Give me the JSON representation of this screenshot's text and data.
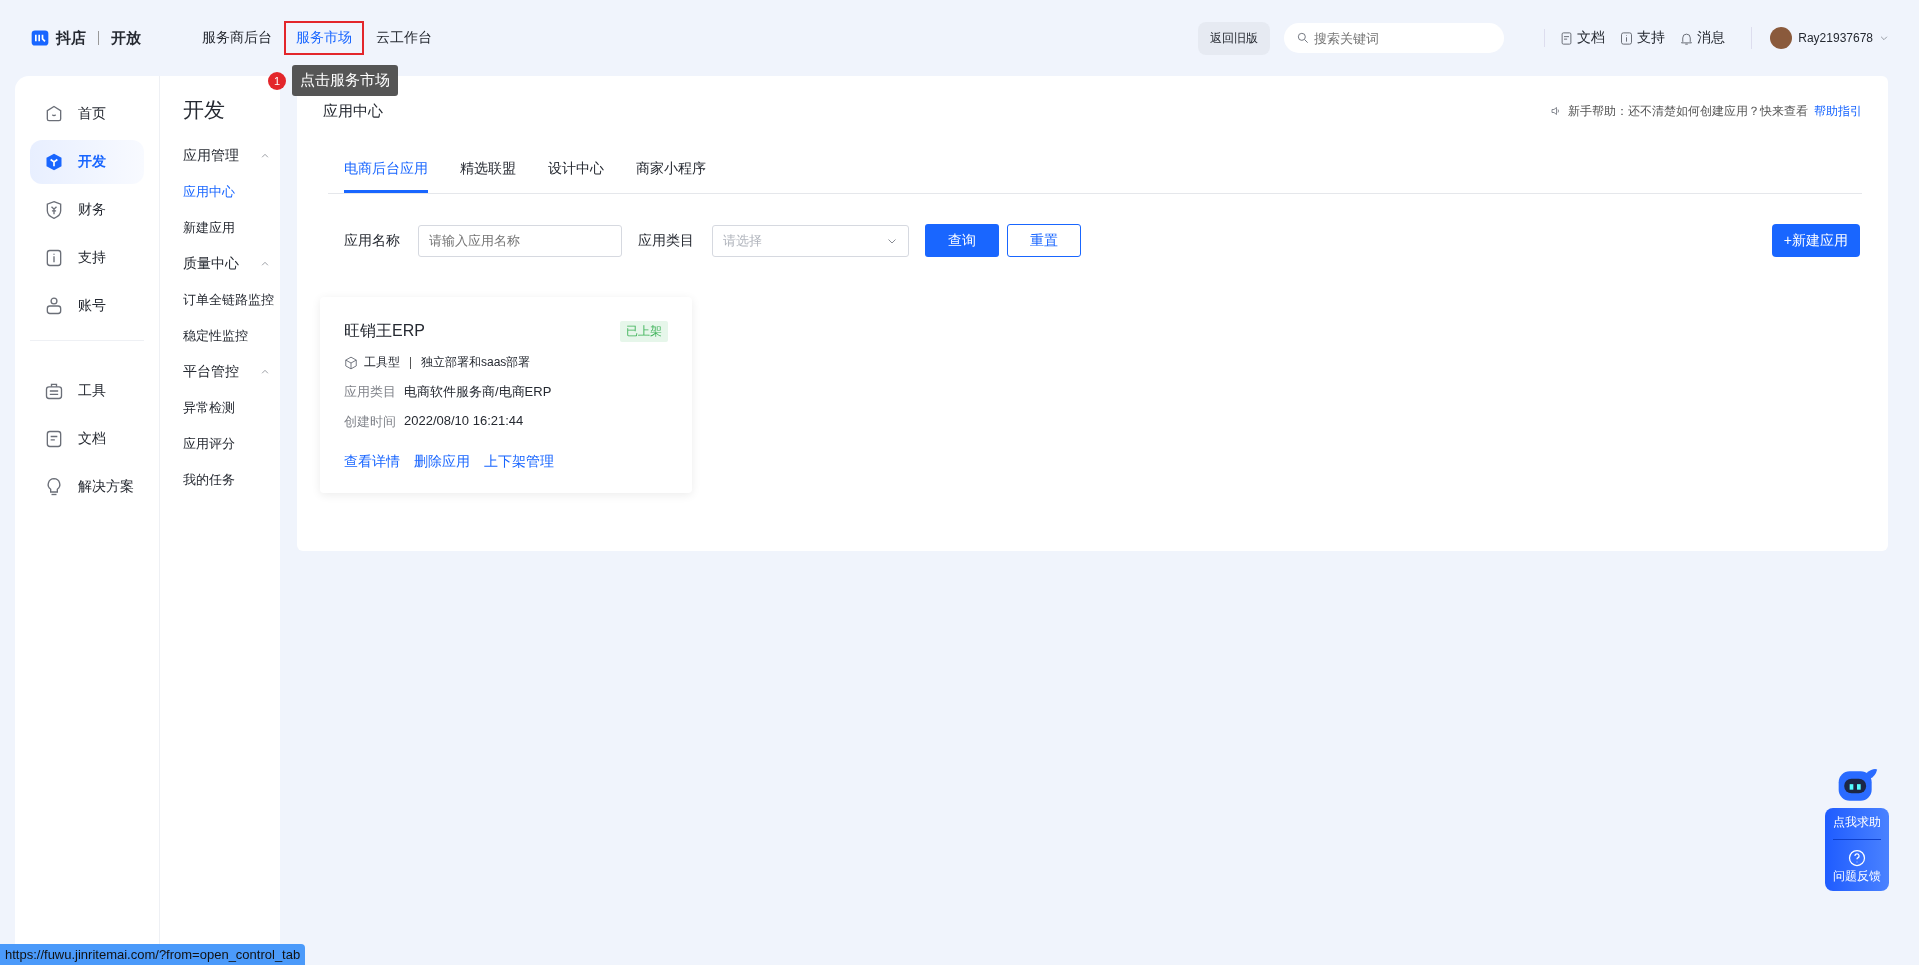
{
  "header": {
    "logo": {
      "brand": "抖店",
      "sub": "开放"
    },
    "nav": [
      {
        "label": "服务商后台",
        "selected": false,
        "outlined": false
      },
      {
        "label": "服务市场",
        "selected": true,
        "outlined": true
      },
      {
        "label": "云工作台",
        "selected": false,
        "outlined": false
      }
    ],
    "guide": {
      "step": "1",
      "text": "点击服务市场"
    },
    "old_version_button": "返回旧版",
    "search": {
      "placeholder": "搜索关键词"
    },
    "links": [
      {
        "label": "文档",
        "kind": "doc"
      },
      {
        "label": "支持",
        "kind": "support"
      },
      {
        "label": "消息",
        "kind": "bell"
      }
    ],
    "user": {
      "name": "Ray21937678"
    }
  },
  "sidebar": {
    "items": [
      {
        "label": "首页",
        "kind": "home",
        "selected": false
      },
      {
        "label": "开发",
        "kind": "dev",
        "selected": true
      },
      {
        "label": "财务",
        "kind": "finance",
        "selected": false
      },
      {
        "label": "支持",
        "kind": "support",
        "selected": false
      },
      {
        "label": "账号",
        "kind": "account",
        "selected": false
      }
    ],
    "tools": [
      {
        "label": "工具",
        "kind": "tools",
        "selected": false
      },
      {
        "label": "文档",
        "kind": "docs",
        "selected": false
      },
      {
        "label": "解决方案",
        "kind": "solution",
        "selected": false
      }
    ]
  },
  "subnav": {
    "title": "开发",
    "groups": [
      {
        "label": "应用管理",
        "expanded": true,
        "items": [
          {
            "label": "应用中心",
            "selected": true
          },
          {
            "label": "新建应用",
            "selected": false
          }
        ]
      },
      {
        "label": "质量中心",
        "expanded": true,
        "items": [
          {
            "label": "订单全链路监控",
            "selected": false
          },
          {
            "label": "稳定性监控",
            "selected": false
          }
        ]
      },
      {
        "label": "平台管控",
        "expanded": true,
        "items": [
          {
            "label": "异常检测",
            "selected": false
          },
          {
            "label": "应用评分",
            "selected": false
          },
          {
            "label": "我的任务",
            "selected": false
          }
        ]
      }
    ]
  },
  "main": {
    "title": "应用中心",
    "help": {
      "text": "新手帮助：还不清楚如何创建应用？快来查看",
      "link": "帮助指引"
    },
    "tabs": [
      {
        "label": "电商后台应用",
        "selected": true
      },
      {
        "label": "精选联盟",
        "selected": false
      },
      {
        "label": "设计中心",
        "selected": false
      },
      {
        "label": "商家小程序",
        "selected": false
      }
    ],
    "filters": {
      "name_label": "应用名称",
      "name_placeholder": "请输入应用名称",
      "category_label": "应用类目",
      "category_placeholder": "请选择",
      "query_button": "查询",
      "reset_button": "重置"
    },
    "new_button": "+新建应用",
    "cards": [
      {
        "title": "旺销王ERP",
        "status": "已上架",
        "type": "工具型",
        "deploy": "独立部署和saas部署",
        "category_label": "应用类目",
        "category": "电商软件服务商/电商ERP",
        "time_label": "创建时间",
        "time": "2022/08/10 16:21:44",
        "actions": [
          "查看详情",
          "删除应用",
          "上下架管理"
        ]
      }
    ]
  },
  "float_widget": {
    "help": "点我求助",
    "feedback": "问题反馈"
  },
  "status_url": "https://fuwu.jinritemai.com/?from=open_control_tab"
}
